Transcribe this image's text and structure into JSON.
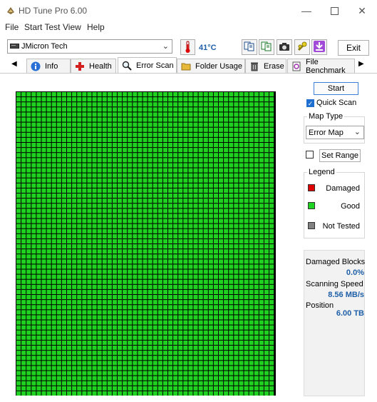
{
  "window": {
    "title": "HD Tune Pro 6.00"
  },
  "menu": {
    "items": [
      {
        "label": "File",
        "key": "F"
      },
      {
        "label": "Start Test",
        "key": "S"
      },
      {
        "label": "View",
        "key": "V"
      },
      {
        "label": "Help",
        "key": ""
      }
    ]
  },
  "toolbar": {
    "drive": "JMicron Tech",
    "temperature": "41°C",
    "exit_label": "Exit"
  },
  "tabs": [
    {
      "label": "Info",
      "icon": "info-icon"
    },
    {
      "label": "Health",
      "icon": "health-cross-icon"
    },
    {
      "label": "Error Scan",
      "icon": "magnifier-icon",
      "active": true
    },
    {
      "label": "Folder Usage",
      "icon": "folder-icon"
    },
    {
      "label": "Erase",
      "icon": "trash-icon"
    },
    {
      "label": "File Benchmark",
      "icon": "file-benchmark-icon"
    }
  ],
  "controls": {
    "start_label": "Start",
    "quick_scan_label": "Quick Scan",
    "quick_scan_checked": true,
    "map_type_title": "Map Type",
    "map_type_value": "Error Map",
    "set_range_label": "Set Range",
    "set_range_checked": false
  },
  "legend": {
    "title": "Legend",
    "items": [
      {
        "label": "Damaged",
        "color": "#e00000"
      },
      {
        "label": "Good",
        "color": "#1fd21f"
      },
      {
        "label": "Not Tested",
        "color": "#808080"
      }
    ]
  },
  "stats": {
    "damaged_label": "Damaged Blocks",
    "damaged_value": "0.0%",
    "speed_label": "Scanning Speed",
    "speed_value": "8.56 MB/s",
    "position_label": "Position",
    "position_value": "6.00 TB"
  },
  "grid": {
    "cell_color": "#1fd21f",
    "line_color": "#000000",
    "state": "Good"
  }
}
